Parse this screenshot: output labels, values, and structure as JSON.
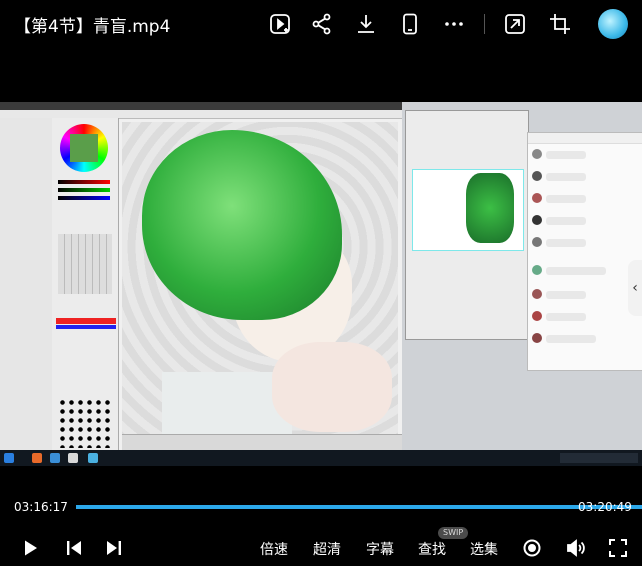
{
  "header": {
    "title": "【第4节】青盲.mp4",
    "icons": [
      "video-add-icon",
      "share-icon",
      "download-icon",
      "phone-icon",
      "more-icon",
      "cast-icon",
      "crop-icon",
      "avatar"
    ]
  },
  "player": {
    "current_time": "03:16:17",
    "total_time": "03:20:49",
    "progress_fraction": 0.985,
    "progress_color": "#2ca8ea"
  },
  "controls": {
    "speed_label": "倍速",
    "quality_label": "超清",
    "subtitle_label": "字幕",
    "search_label": "查找",
    "search_badge": "SWIP",
    "episodes_label": "选集"
  }
}
